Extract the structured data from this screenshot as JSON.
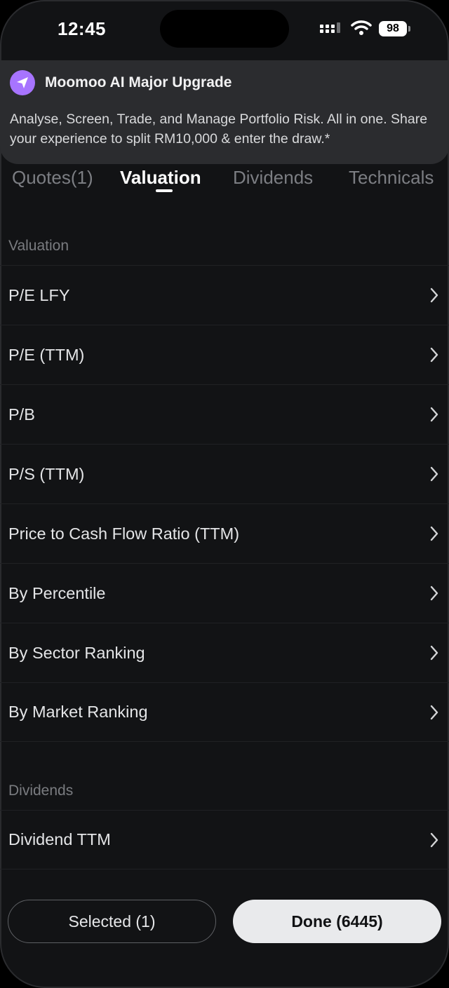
{
  "status_bar": {
    "time": "12:45",
    "battery": "98"
  },
  "banner": {
    "title": "Moomoo AI Major Upgrade",
    "body": "Analyse, Screen, Trade, and Manage Portfolio Risk. All in one. Share your experience to split RM10,000 & enter the draw.*"
  },
  "tabs": [
    {
      "label": "Quotes(1)",
      "active": false
    },
    {
      "label": "Valuation",
      "active": true
    },
    {
      "label": "Dividends",
      "active": false
    },
    {
      "label": "Technicals",
      "active": false
    }
  ],
  "sections": {
    "valuation": {
      "title": "Valuation",
      "items": [
        "P/E LFY",
        "P/E (TTM)",
        "P/B",
        "P/S (TTM)",
        "Price to Cash Flow Ratio (TTM)",
        "By Percentile",
        "By Sector Ranking",
        "By Market Ranking"
      ]
    },
    "dividends": {
      "title": "Dividends",
      "items": [
        "Dividend TTM"
      ]
    }
  },
  "footer": {
    "selected_label": "Selected (1)",
    "done_label": "Done (6445)"
  },
  "colors": {
    "accent": "#a774ff",
    "background": "#121315",
    "banner": "#2b2c2f"
  }
}
